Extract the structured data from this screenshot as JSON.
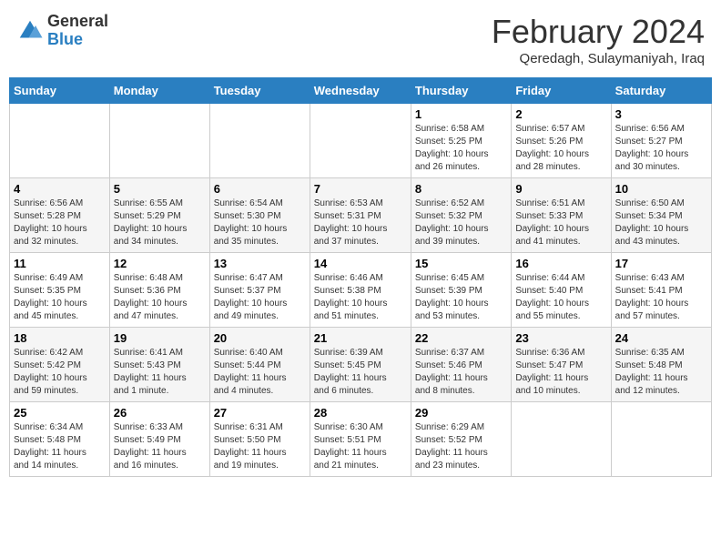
{
  "header": {
    "logo_general": "General",
    "logo_blue": "Blue",
    "month_title": "February 2024",
    "location": "Qeredagh, Sulaymaniyah, Iraq"
  },
  "weekdays": [
    "Sunday",
    "Monday",
    "Tuesday",
    "Wednesday",
    "Thursday",
    "Friday",
    "Saturday"
  ],
  "weeks": [
    [
      {
        "day": "",
        "info": ""
      },
      {
        "day": "",
        "info": ""
      },
      {
        "day": "",
        "info": ""
      },
      {
        "day": "",
        "info": ""
      },
      {
        "day": "1",
        "info": "Sunrise: 6:58 AM\nSunset: 5:25 PM\nDaylight: 10 hours\nand 26 minutes."
      },
      {
        "day": "2",
        "info": "Sunrise: 6:57 AM\nSunset: 5:26 PM\nDaylight: 10 hours\nand 28 minutes."
      },
      {
        "day": "3",
        "info": "Sunrise: 6:56 AM\nSunset: 5:27 PM\nDaylight: 10 hours\nand 30 minutes."
      }
    ],
    [
      {
        "day": "4",
        "info": "Sunrise: 6:56 AM\nSunset: 5:28 PM\nDaylight: 10 hours\nand 32 minutes."
      },
      {
        "day": "5",
        "info": "Sunrise: 6:55 AM\nSunset: 5:29 PM\nDaylight: 10 hours\nand 34 minutes."
      },
      {
        "day": "6",
        "info": "Sunrise: 6:54 AM\nSunset: 5:30 PM\nDaylight: 10 hours\nand 35 minutes."
      },
      {
        "day": "7",
        "info": "Sunrise: 6:53 AM\nSunset: 5:31 PM\nDaylight: 10 hours\nand 37 minutes."
      },
      {
        "day": "8",
        "info": "Sunrise: 6:52 AM\nSunset: 5:32 PM\nDaylight: 10 hours\nand 39 minutes."
      },
      {
        "day": "9",
        "info": "Sunrise: 6:51 AM\nSunset: 5:33 PM\nDaylight: 10 hours\nand 41 minutes."
      },
      {
        "day": "10",
        "info": "Sunrise: 6:50 AM\nSunset: 5:34 PM\nDaylight: 10 hours\nand 43 minutes."
      }
    ],
    [
      {
        "day": "11",
        "info": "Sunrise: 6:49 AM\nSunset: 5:35 PM\nDaylight: 10 hours\nand 45 minutes."
      },
      {
        "day": "12",
        "info": "Sunrise: 6:48 AM\nSunset: 5:36 PM\nDaylight: 10 hours\nand 47 minutes."
      },
      {
        "day": "13",
        "info": "Sunrise: 6:47 AM\nSunset: 5:37 PM\nDaylight: 10 hours\nand 49 minutes."
      },
      {
        "day": "14",
        "info": "Sunrise: 6:46 AM\nSunset: 5:38 PM\nDaylight: 10 hours\nand 51 minutes."
      },
      {
        "day": "15",
        "info": "Sunrise: 6:45 AM\nSunset: 5:39 PM\nDaylight: 10 hours\nand 53 minutes."
      },
      {
        "day": "16",
        "info": "Sunrise: 6:44 AM\nSunset: 5:40 PM\nDaylight: 10 hours\nand 55 minutes."
      },
      {
        "day": "17",
        "info": "Sunrise: 6:43 AM\nSunset: 5:41 PM\nDaylight: 10 hours\nand 57 minutes."
      }
    ],
    [
      {
        "day": "18",
        "info": "Sunrise: 6:42 AM\nSunset: 5:42 PM\nDaylight: 10 hours\nand 59 minutes."
      },
      {
        "day": "19",
        "info": "Sunrise: 6:41 AM\nSunset: 5:43 PM\nDaylight: 11 hours\nand 1 minute."
      },
      {
        "day": "20",
        "info": "Sunrise: 6:40 AM\nSunset: 5:44 PM\nDaylight: 11 hours\nand 4 minutes."
      },
      {
        "day": "21",
        "info": "Sunrise: 6:39 AM\nSunset: 5:45 PM\nDaylight: 11 hours\nand 6 minutes."
      },
      {
        "day": "22",
        "info": "Sunrise: 6:37 AM\nSunset: 5:46 PM\nDaylight: 11 hours\nand 8 minutes."
      },
      {
        "day": "23",
        "info": "Sunrise: 6:36 AM\nSunset: 5:47 PM\nDaylight: 11 hours\nand 10 minutes."
      },
      {
        "day": "24",
        "info": "Sunrise: 6:35 AM\nSunset: 5:48 PM\nDaylight: 11 hours\nand 12 minutes."
      }
    ],
    [
      {
        "day": "25",
        "info": "Sunrise: 6:34 AM\nSunset: 5:48 PM\nDaylight: 11 hours\nand 14 minutes."
      },
      {
        "day": "26",
        "info": "Sunrise: 6:33 AM\nSunset: 5:49 PM\nDaylight: 11 hours\nand 16 minutes."
      },
      {
        "day": "27",
        "info": "Sunrise: 6:31 AM\nSunset: 5:50 PM\nDaylight: 11 hours\nand 19 minutes."
      },
      {
        "day": "28",
        "info": "Sunrise: 6:30 AM\nSunset: 5:51 PM\nDaylight: 11 hours\nand 21 minutes."
      },
      {
        "day": "29",
        "info": "Sunrise: 6:29 AM\nSunset: 5:52 PM\nDaylight: 11 hours\nand 23 minutes."
      },
      {
        "day": "",
        "info": ""
      },
      {
        "day": "",
        "info": ""
      }
    ]
  ]
}
